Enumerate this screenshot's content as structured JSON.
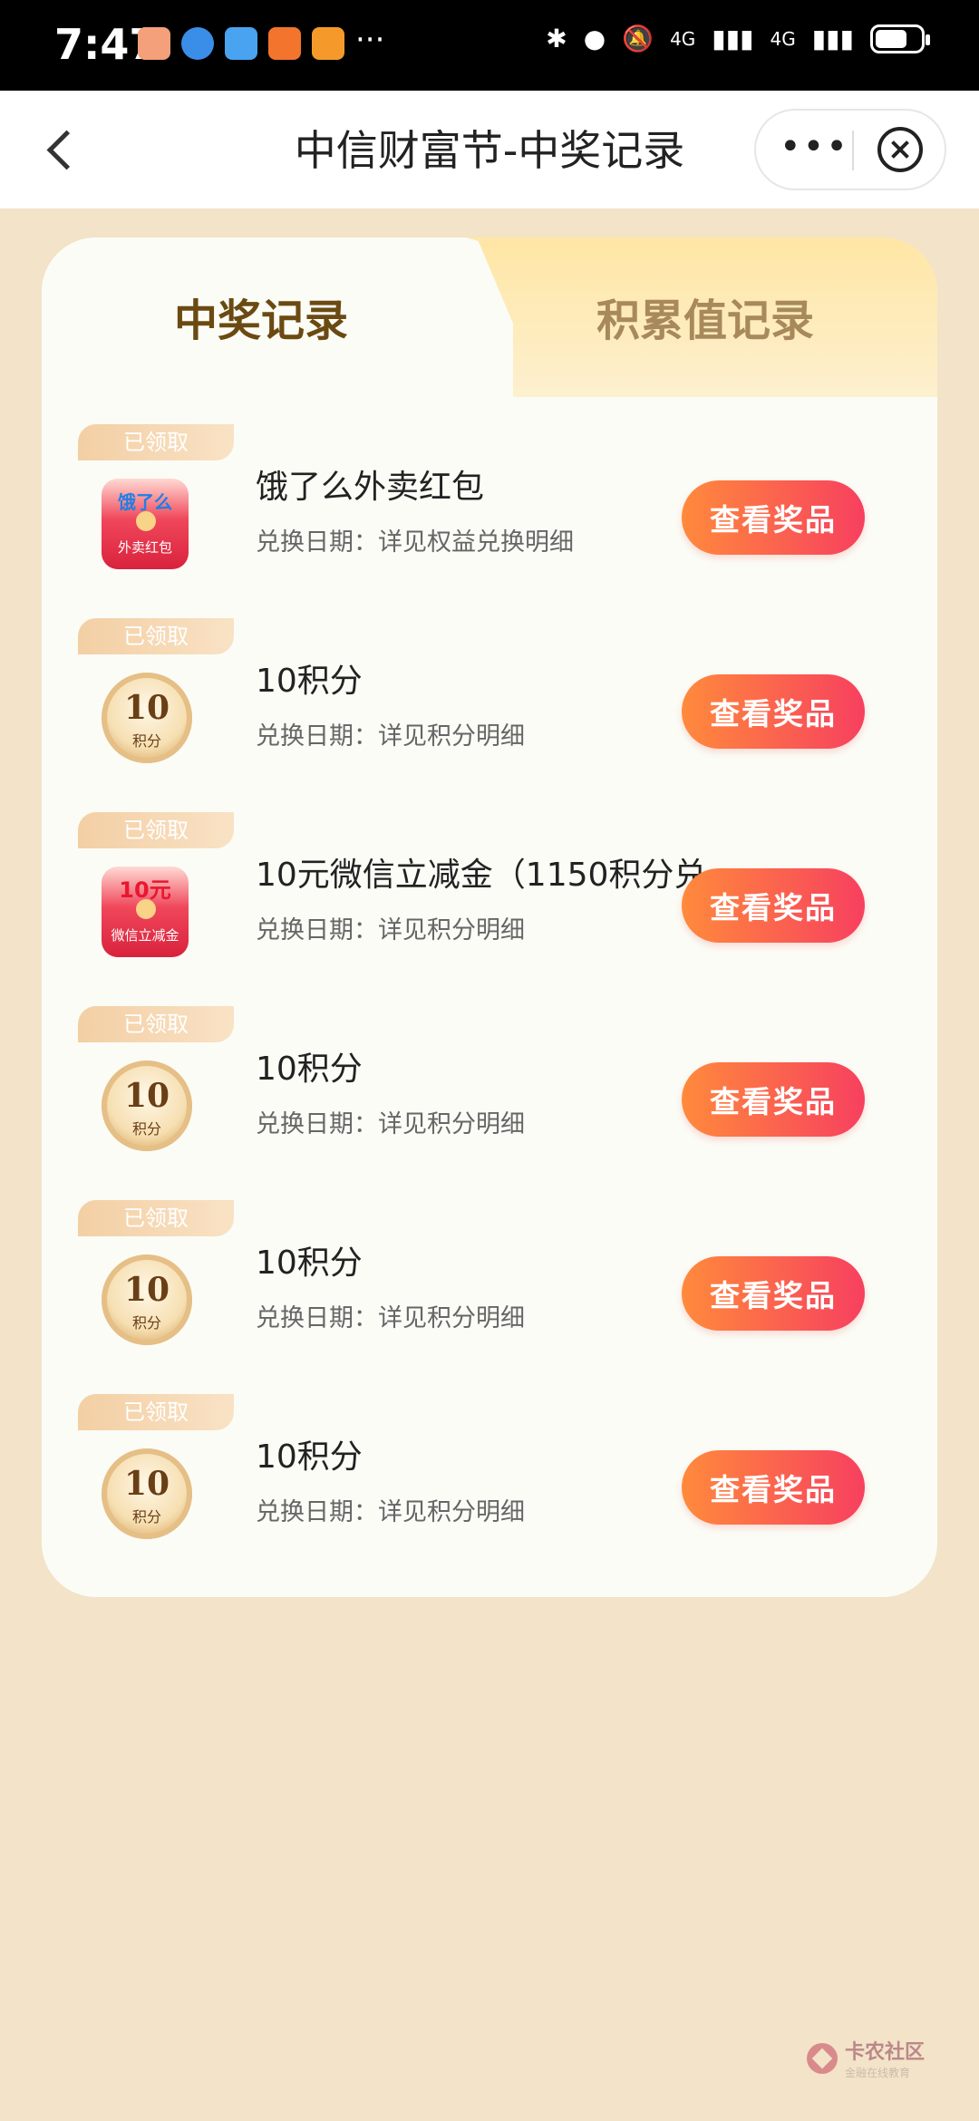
{
  "status_bar": {
    "time": "7:47",
    "more_glyph": "···",
    "network_1": "4G",
    "network_2": "4G",
    "battery_level": 0.7,
    "icons": [
      "bluetooth-icon",
      "location-icon",
      "mute-bell-icon",
      "signal-icon",
      "battery-icon"
    ]
  },
  "header": {
    "title": "中信财富节-中奖记录",
    "more_label": "•••"
  },
  "tabs": [
    {
      "label": "中奖记录",
      "active": true
    },
    {
      "label": "积累值记录",
      "active": false
    }
  ],
  "prizes": [
    {
      "badge": "已领取",
      "name": "饿了么外卖红包",
      "date_label": "兑换日期：",
      "date_value": "详见权益兑换明细",
      "button": "查看奖品",
      "icon": "eleme-red-packet-icon",
      "icon_top": "饿了么",
      "icon_bottom": "外卖红包"
    },
    {
      "badge": "已领取",
      "name": "10积分",
      "date_label": "兑换日期：",
      "date_value": "详见积分明细",
      "button": "查看奖品",
      "icon": "points-coin-icon",
      "icon_top": "10",
      "icon_bottom": "积分"
    },
    {
      "badge": "已领取",
      "name": "10元微信立减金（1150积分兑…",
      "date_label": "兑换日期：",
      "date_value": "详见积分明细",
      "button": "查看奖品",
      "icon": "wechat-voucher-red-packet-icon",
      "icon_top": "10元",
      "icon_bottom": "微信立减金"
    },
    {
      "badge": "已领取",
      "name": "10积分",
      "date_label": "兑换日期：",
      "date_value": "详见积分明细",
      "button": "查看奖品",
      "icon": "points-coin-icon",
      "icon_top": "10",
      "icon_bottom": "积分"
    },
    {
      "badge": "已领取",
      "name": "10积分",
      "date_label": "兑换日期：",
      "date_value": "详见积分明细",
      "button": "查看奖品",
      "icon": "points-coin-icon",
      "icon_top": "10",
      "icon_bottom": "积分"
    },
    {
      "badge": "已领取",
      "name": "10积分",
      "date_label": "兑换日期：",
      "date_value": "详见积分明细",
      "button": "查看奖品",
      "icon": "points-coin-icon",
      "icon_top": "10",
      "icon_bottom": "积分"
    }
  ],
  "watermark": {
    "title": "卡农社区",
    "subtitle": "金融在线教育"
  },
  "colors": {
    "background": "#f2e3c9",
    "button_start": "#ff8a3c",
    "button_end": "#f7405f",
    "active_tab": "#6b4a12"
  }
}
